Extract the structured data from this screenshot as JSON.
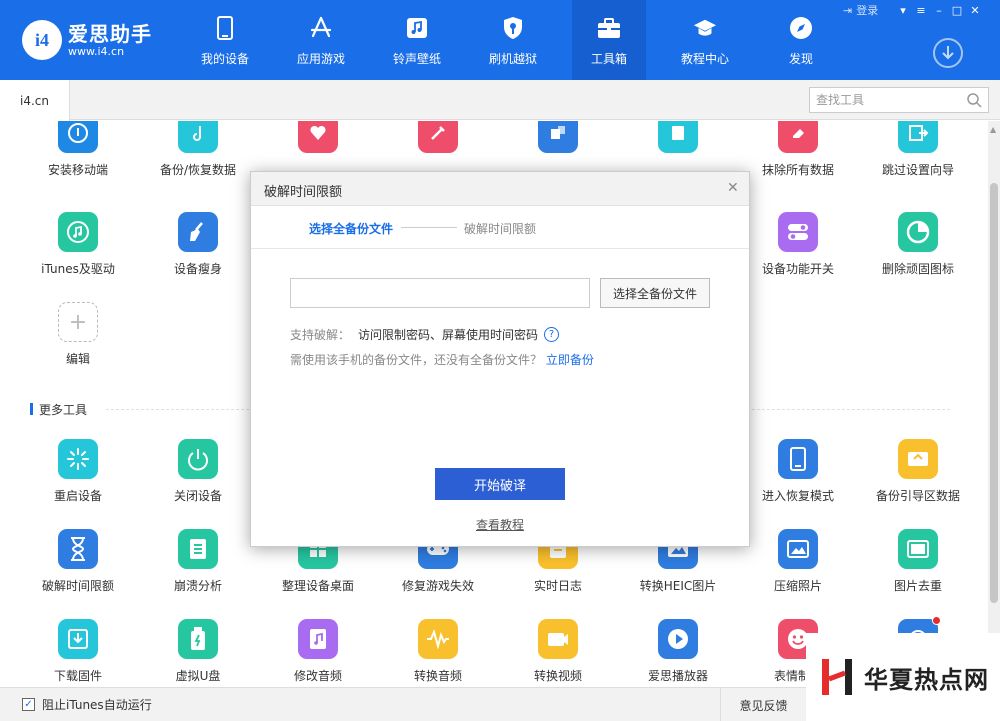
{
  "app": {
    "name": "爱思助手",
    "url": "www.i4.cn",
    "logo_mark": "i4"
  },
  "window": {
    "login": "登录"
  },
  "nav": [
    {
      "label": "我的设备",
      "icon": "phone-icon"
    },
    {
      "label": "应用游戏",
      "icon": "app-store-icon"
    },
    {
      "label": "铃声壁纸",
      "icon": "music-note-icon"
    },
    {
      "label": "刷机越狱",
      "icon": "shield-key-icon"
    },
    {
      "label": "工具箱",
      "icon": "toolbox-icon",
      "active": true
    },
    {
      "label": "教程中心",
      "icon": "graduation-cap-icon"
    },
    {
      "label": "发现",
      "icon": "compass-icon"
    }
  ],
  "tabs": {
    "home": "i4.cn"
  },
  "search": {
    "placeholder": "查找工具"
  },
  "tools_top": [
    {
      "label": "安装移动端",
      "color": "#1e88e5",
      "icon": "install-mobile-icon"
    },
    {
      "label": "备份/恢复数据",
      "color": "#26c6da",
      "icon": "backup-restore-icon"
    },
    {
      "label": "",
      "color": "#ef4e6a",
      "icon": "heart-icon"
    },
    {
      "label": "",
      "color": "#ef4e6a",
      "icon": "tools-icon"
    },
    {
      "label": "",
      "color": "#2f7de1",
      "icon": "transfer-icon"
    },
    {
      "label": "",
      "color": "#26c6da",
      "icon": "edit-icon"
    },
    {
      "label": "抹除所有数据",
      "color": "#ef4e6a",
      "icon": "eraser-icon"
    },
    {
      "label": "跳过设置向导",
      "color": "#26c6da",
      "icon": "skip-setup-icon"
    },
    {
      "label": "iTunes及驱动",
      "color": "#26c6a0",
      "icon": "itunes-icon"
    },
    {
      "label": "设备瘦身",
      "color": "#2f7de1",
      "icon": "broom-icon"
    },
    {
      "label": "设备功能开关",
      "color": "#a96cf0",
      "icon": "toggle-switch-icon"
    },
    {
      "label": "删除顽固图标",
      "color": "#26c6a0",
      "icon": "pie-chart-icon"
    }
  ],
  "edit_tile": {
    "label": "编辑"
  },
  "more_tools": {
    "title": "更多工具",
    "items": [
      {
        "label": "重启设备",
        "color": "#26c6da",
        "icon": "restart-icon"
      },
      {
        "label": "关闭设备",
        "color": "#26c6a0",
        "icon": "power-icon"
      },
      {
        "label": "进入恢复模式",
        "color": "#2f7de1",
        "icon": "recovery-mode-icon"
      },
      {
        "label": "备份引导区数据",
        "color": "#f9c02d",
        "icon": "disk-backup-icon"
      },
      {
        "label": "破解时间限额",
        "color": "#2f7de1",
        "icon": "hourglass-icon"
      },
      {
        "label": "崩溃分析",
        "color": "#26c6a0",
        "icon": "crash-log-icon"
      },
      {
        "label": "整理设备桌面",
        "color": "#26c6a0",
        "icon": "desktop-grid-icon"
      },
      {
        "label": "修复游戏失效",
        "color": "#2f7de1",
        "icon": "gamepad-icon"
      },
      {
        "label": "实时日志",
        "color": "#f9c02d",
        "icon": "log-icon"
      },
      {
        "label": "转换HEIC图片",
        "color": "#2f7de1",
        "icon": "heic-convert-icon"
      },
      {
        "label": "压缩照片",
        "color": "#2f7de1",
        "icon": "compress-photo-icon"
      },
      {
        "label": "图片去重",
        "color": "#26c6a0",
        "icon": "dedupe-images-icon"
      },
      {
        "label": "下载固件",
        "color": "#26c6da",
        "icon": "download-firmware-icon"
      },
      {
        "label": "虚拟U盘",
        "color": "#26c6a0",
        "icon": "virtual-usb-icon"
      },
      {
        "label": "修改音频",
        "color": "#a96cf0",
        "icon": "audio-edit-icon"
      },
      {
        "label": "转换音频",
        "color": "#f9c02d",
        "icon": "audio-wave-icon"
      },
      {
        "label": "转换视频",
        "color": "#f9c02d",
        "icon": "video-convert-icon"
      },
      {
        "label": "爱思播放器",
        "color": "#2f7de1",
        "icon": "play-icon"
      },
      {
        "label": "表情制作",
        "color": "#ef4e6a",
        "icon": "emoji-icon"
      },
      {
        "label": "",
        "color": "#2f7de1",
        "icon": "extra-tool-icon"
      }
    ]
  },
  "bottom": {
    "block_itunes": "阻止iTunes自动运行",
    "feedback": "意见反馈"
  },
  "dialog": {
    "title": "破解时间限额",
    "step1": "选择全备份文件",
    "step2": "破解时间限额",
    "path_value": "",
    "choose_button": "选择全备份文件",
    "support_label": "支持破解：",
    "support_items": "访问限制密码、屏幕使用时间密码",
    "note": "需使用该手机的备份文件，还没有全备份文件？",
    "backup_link": "立即备份",
    "start_button": "开始破译",
    "tutorial_link": "查看教程"
  },
  "watermark": {
    "text": "华夏热点网"
  }
}
